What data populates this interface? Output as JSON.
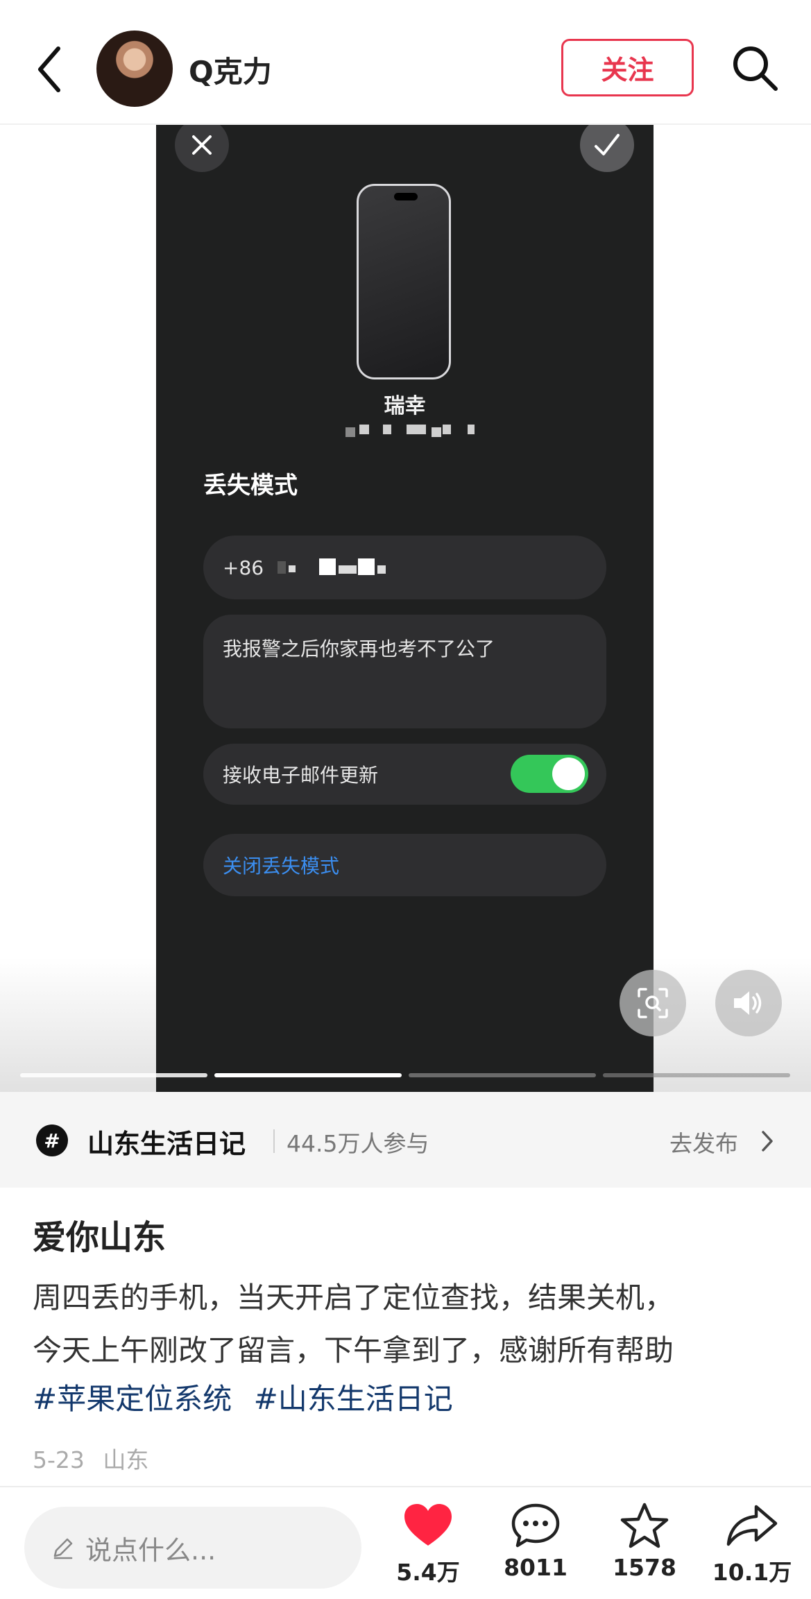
{
  "header": {
    "username": "Q克力",
    "follow_label": "关注"
  },
  "media": {
    "device_name": "瑞幸",
    "section_title": "丢失模式",
    "phone_prefix": "+86",
    "message": "我报警之后你家再也考不了公了",
    "email_updates_label": "接收电子邮件更新",
    "email_updates_on": true,
    "disable_lost_mode_label": "关闭丢失模式",
    "slides_total": 4,
    "slide_current": 2
  },
  "topic": {
    "icon": "#",
    "name": "山东生活日记",
    "participants": "44.5万人参与",
    "publish_label": "去发布"
  },
  "post": {
    "title": "爱你山东",
    "body_line1": "周四丢的手机，当天开启了定位查找，结果关机，",
    "body_line2": "今天上午刚改了留言，下午拿到了，感谢所有帮助",
    "tags": [
      "#苹果定位系统",
      "#山东生活日记"
    ],
    "date": "5-23",
    "location": "山东"
  },
  "bottom": {
    "comment_placeholder": "说点什么...",
    "likes": "5.4万",
    "comments": "8011",
    "favorites": "1578",
    "shares": "10.1万"
  },
  "colors": {
    "accent": "#e8364e",
    "like": "#ff2442",
    "toggle": "#34c759",
    "link": "#3b8ef0",
    "tag": "#13386c"
  }
}
